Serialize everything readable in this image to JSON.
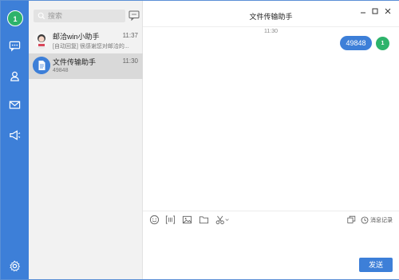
{
  "user": {
    "avatar_label": "1"
  },
  "sidebar": {
    "items": [
      {
        "icon": "chat-bubble-icon",
        "active": true
      },
      {
        "icon": "contacts-icon",
        "active": false
      },
      {
        "icon": "mail-icon",
        "active": false
      },
      {
        "icon": "megaphone-icon",
        "active": false
      }
    ],
    "settings_icon": "gear-icon",
    "color": "#3d7fd8"
  },
  "search": {
    "placeholder": "搜索"
  },
  "conversations": [
    {
      "name": "邮洽win小助手",
      "time": "11:37",
      "preview": "[自动回复] 很感谢您对邮洽的...",
      "active": false,
      "avatar": "assistant-avatar"
    },
    {
      "name": "文件传输助手",
      "time": "11:30",
      "preview": "49848",
      "active": true,
      "avatar": "file-transfer-avatar"
    }
  ],
  "chat": {
    "title": "文件传输助手",
    "messages": [
      {
        "time": "11:30",
        "text": "49848",
        "sender_avatar": "1"
      }
    ],
    "toolbar": {
      "tools": [
        "emoji-icon",
        "screenshot-area-icon",
        "image-icon",
        "folder-icon",
        "scissors-icon"
      ],
      "window_icon": "multi-window-icon",
      "history_label": "消息记录"
    },
    "send_label": "发送"
  },
  "colors": {
    "accent": "#3d7fd8",
    "avatar_green": "#2db36b",
    "list_bg": "#f2f2f2",
    "active_row": "#d9d9d9"
  }
}
